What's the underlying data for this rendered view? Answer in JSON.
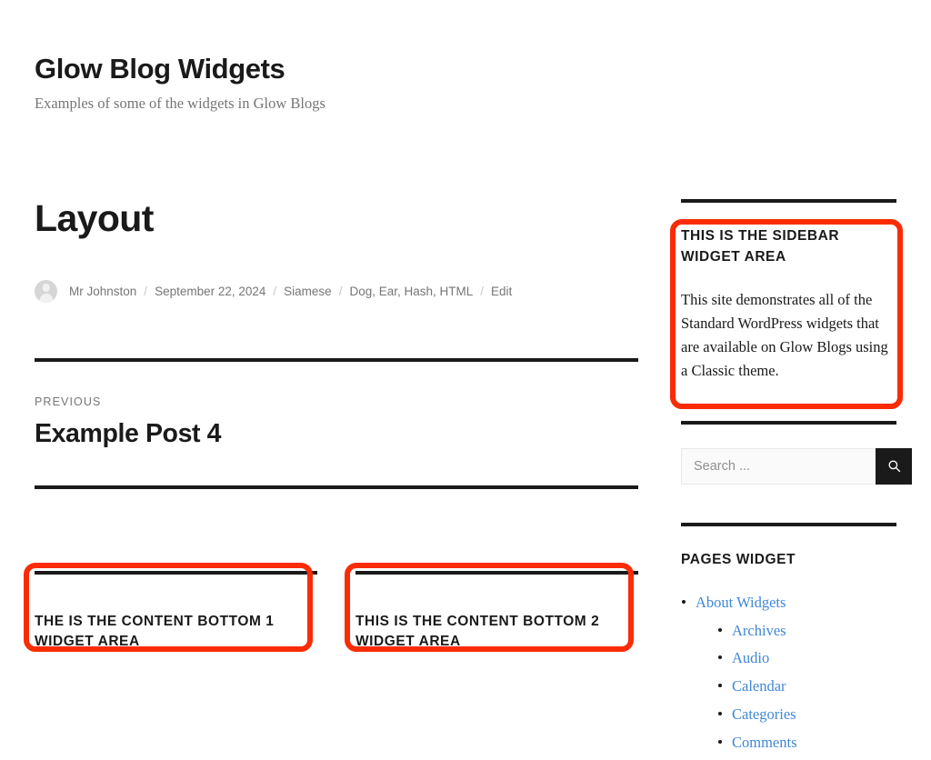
{
  "site": {
    "title": "Glow Blog Widgets",
    "description": "Examples of some of the widgets in Glow Blogs"
  },
  "post": {
    "title": "Layout",
    "meta": {
      "author": "Mr Johnston",
      "date": "September 22, 2024",
      "category": "Siamese",
      "tags": "Dog, Ear, Hash, HTML",
      "edit": "Edit",
      "separator": "/"
    }
  },
  "post_navigation": {
    "previous_label": "PREVIOUS",
    "previous_title": "Example Post 4"
  },
  "content_bottom": [
    {
      "title": "THE IS THE CONTENT BOTTOM 1 WIDGET AREA"
    },
    {
      "title": "THIS IS THE CONTENT BOTTOM 2 WIDGET AREA"
    }
  ],
  "sidebar": {
    "text_widget": {
      "title": "THIS IS THE SIDEBAR WIDGET AREA",
      "body": "This site demonstrates all of the Standard WordPress widgets that are available on Glow Blogs using a Classic theme."
    },
    "search": {
      "placeholder": "Search ...",
      "value": "",
      "icon": "search-icon"
    },
    "pages_widget": {
      "title": "PAGES WIDGET",
      "items": [
        {
          "label": "About Widgets",
          "children": [
            {
              "label": "Archives"
            },
            {
              "label": "Audio"
            },
            {
              "label": "Calendar"
            },
            {
              "label": "Categories"
            },
            {
              "label": "Comments"
            }
          ]
        }
      ]
    }
  },
  "colors": {
    "annotation_red": "#f92c06",
    "link_blue": "#3f87d6",
    "text": "#1a1a1a",
    "muted": "#767676"
  }
}
